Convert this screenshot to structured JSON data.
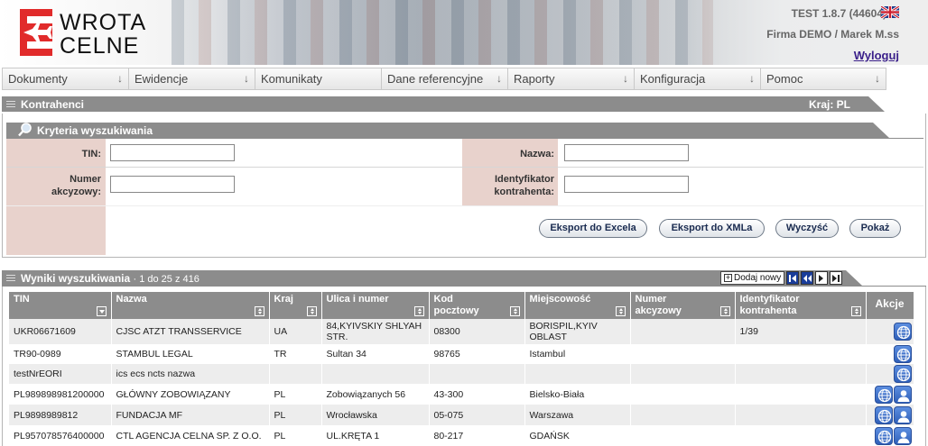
{
  "header": {
    "logo_line1": "WROTA",
    "logo_line2": "CELNE",
    "version": "TEST  1.8.7 (44604)",
    "user": "Firma DEMO / Marek M.ss",
    "logout": "Wyloguj",
    "flag_icon": "uk-flag-icon"
  },
  "menu": [
    {
      "label": "Dokumenty",
      "dropdown": true
    },
    {
      "label": "Ewidencje",
      "dropdown": true
    },
    {
      "label": "Komunikaty",
      "dropdown": false
    },
    {
      "label": "Dane referencyjne",
      "dropdown": true
    },
    {
      "label": "Raporty",
      "dropdown": true
    },
    {
      "label": "Konfiguracja",
      "dropdown": true
    },
    {
      "label": "Pomoc",
      "dropdown": true
    }
  ],
  "kontrahenci": {
    "title": "Kontrahenci",
    "country": "Kraj: PL"
  },
  "criteria": {
    "title": "Kryteria wyszukiwania",
    "tin_label": "TIN:",
    "tin_value": "",
    "excise_label_1": "Numer",
    "excise_label_2": "akcyzowy:",
    "excise_value": "",
    "name_label": "Nazwa:",
    "name_value": "",
    "id_label_1": "Identyfikator",
    "id_label_2": "kontrahenta:",
    "id_value": "",
    "buttons": {
      "export_excel": "Eksport do Excela",
      "export_xml": "Eksport do XMLa",
      "clear": "Wyczyść",
      "show": "Pokaż"
    }
  },
  "results": {
    "title": "Wyniki wyszukiwania",
    "range": "· 1 do 25 z 416",
    "add_new": "Dodaj nowy",
    "columns": {
      "tin": "TIN",
      "name": "Nazwa",
      "country": "Kraj",
      "street": "Ulica i numer",
      "postal_1": "Kod",
      "postal_2": "pocztowy",
      "city": "Miejscowość",
      "excise_1": "Numer",
      "excise_2": "akcyzowy",
      "id_1": "Identyfikator",
      "id_2": "kontrahenta",
      "actions": "Akcje"
    },
    "rows": [
      {
        "tin": "UKR06671609",
        "name": "CJSC ATZT TRANSSERVICE",
        "country": "UA",
        "street": "84,KYIVSKIY SHLYAH STR.",
        "postal": "08300",
        "city": "BORISPIL,KYIV OBLAST",
        "excise": "",
        "id": "1/39",
        "actions": [
          "globe-icon"
        ]
      },
      {
        "tin": "TR90-0989",
        "name": "STAMBUL LEGAL",
        "country": "TR",
        "street": "Sultan 34",
        "postal": "98765",
        "city": "Istambul",
        "excise": "",
        "id": "",
        "actions": [
          "globe-icon"
        ]
      },
      {
        "tin": "testNrEORI",
        "name": "ics ecs ncts nazwa",
        "country": "",
        "street": "",
        "postal": "",
        "city": "",
        "excise": "",
        "id": "",
        "actions": [
          "globe-icon"
        ]
      },
      {
        "tin": "PL989898981200000",
        "name": "GŁÓWNY ZOBOWIĄZANY",
        "country": "PL",
        "street": "Zobowiązanych 56",
        "postal": "43-300",
        "city": "Bielsko-Biała",
        "excise": "",
        "id": "",
        "actions": [
          "globe-icon",
          "person-icon"
        ]
      },
      {
        "tin": "PL9898989812",
        "name": "FUNDACJA MF",
        "country": "PL",
        "street": "Wrocławska",
        "postal": "05-075",
        "city": "Warszawa",
        "excise": "",
        "id": "",
        "actions": [
          "globe-icon",
          "person-icon"
        ]
      },
      {
        "tin": "PL957078576400000",
        "name": "CTL AGENCJA CELNA SP. Z O.O.",
        "country": "PL",
        "street": "UL.KRĘTA 1",
        "postal": "80-217",
        "city": "GDAŃSK",
        "excise": "",
        "id": "",
        "actions": [
          "globe-icon",
          "person-icon"
        ]
      }
    ]
  }
}
